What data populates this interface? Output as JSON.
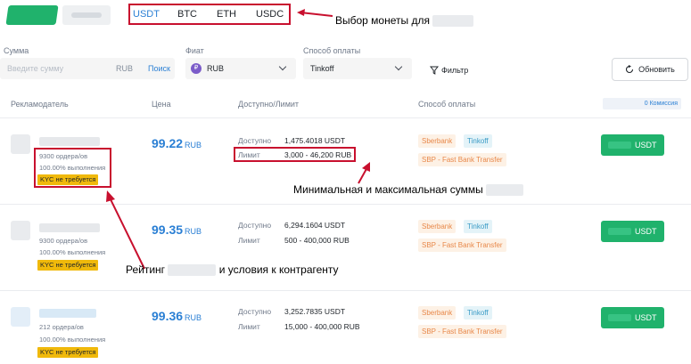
{
  "coins": [
    "USDT",
    "BTC",
    "ETH",
    "USDC"
  ],
  "annotations": {
    "coin_choice": "Выбор монеты для",
    "min_max": "Минимальная и максимальная суммы",
    "rating": "Рейтинг",
    "rating_tail": "и условия к контрагенту"
  },
  "filters": {
    "amount_label": "Сумма",
    "amount_placeholder": "Введите сумму",
    "amount_unit": "RUB",
    "search_label": "Поиск",
    "fiat_label": "Фиат",
    "fiat_value": "RUB",
    "fiat_icon": "₽",
    "payment_label": "Способ оплаты",
    "payment_value": "Tinkoff",
    "filter_label": "Фильтр",
    "refresh_label": "Обновить"
  },
  "table": {
    "headers": {
      "advertiser": "Рекламодатель",
      "price": "Цена",
      "available": "Доступно/Лимит",
      "payment": "Способ оплаты",
      "fee": "0 Комиссия"
    },
    "available_label": "Доступно",
    "limit_label": "Лимит",
    "rows": [
      {
        "orders": "9300 ордера/ов",
        "completion": "100.00% выполнения",
        "kyc": "KYC не требуется",
        "price": "99.22",
        "price_currency": "RUB",
        "available": "1,475.4018 USDT",
        "limit": "3,000 - 46,200 RUB",
        "methods": [
          "Sberbank",
          "Tinkoff",
          "SBP - Fast Bank Transfer"
        ],
        "button": "USDT"
      },
      {
        "orders": "9300 ордера/ов",
        "completion": "100.00% выполнения",
        "kyc": "KYC не требуется",
        "price": "99.35",
        "price_currency": "RUB",
        "available": "6,294.1604 USDT",
        "limit": "500 - 400,000 RUB",
        "methods": [
          "Sberbank",
          "Tinkoff",
          "SBP - Fast Bank Transfer"
        ],
        "button": "USDT"
      },
      {
        "orders": "212 ордера/ов",
        "completion": "100.00% выполнения",
        "kyc": "KYC не требуется",
        "price": "99.36",
        "price_currency": "RUB",
        "available": "3,252.7835 USDT",
        "limit": "15,000 - 400,000 RUB",
        "methods": [
          "Sberbank",
          "Tinkoff",
          "SBP - Fast Bank Transfer"
        ],
        "button": "USDT"
      }
    ]
  },
  "colors": {
    "accent_blue": "#2a7fd4",
    "buy_green": "#20b26c",
    "kyc_yellow": "#f0b90b",
    "annotation_red": "#c8102e"
  }
}
